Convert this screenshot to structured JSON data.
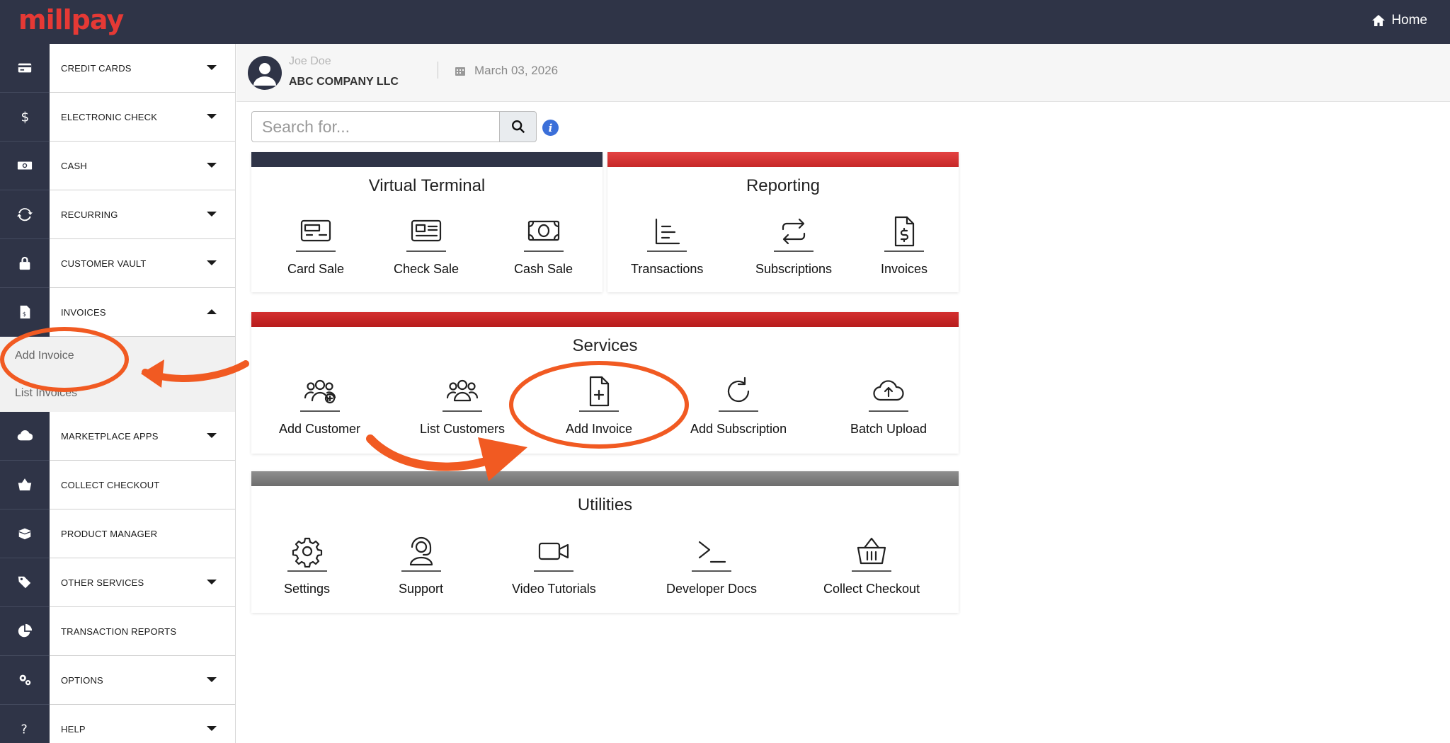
{
  "topbar": {
    "logo": "millpay",
    "home_label": "Home"
  },
  "sidebar": {
    "items": [
      {
        "label": "CREDIT CARDS",
        "icon": "credit-card-icon",
        "caret": "down"
      },
      {
        "label": "ELECTRONIC CHECK",
        "icon": "dollar-icon",
        "caret": "down"
      },
      {
        "label": "CASH",
        "icon": "cash-icon",
        "caret": "down"
      },
      {
        "label": "RECURRING",
        "icon": "refresh-icon",
        "caret": "down"
      },
      {
        "label": "CUSTOMER VAULT",
        "icon": "lock-icon",
        "caret": "down"
      },
      {
        "label": "INVOICES",
        "icon": "invoice-file-icon",
        "caret": "up"
      },
      {
        "label": "MARKETPLACE APPS",
        "icon": "cloud-icon",
        "caret": "down"
      },
      {
        "label": "COLLECT CHECKOUT",
        "icon": "basket-icon",
        "caret": "none"
      },
      {
        "label": "PRODUCT MANAGER",
        "icon": "box-icon",
        "caret": "none"
      },
      {
        "label": "OTHER SERVICES",
        "icon": "tags-icon",
        "caret": "down"
      },
      {
        "label": "TRANSACTION REPORTS",
        "icon": "pie-chart-icon",
        "caret": "none"
      },
      {
        "label": "OPTIONS",
        "icon": "gears-icon",
        "caret": "down"
      },
      {
        "label": "HELP",
        "icon": "question-icon",
        "caret": "down"
      }
    ],
    "invoices_sub": [
      "Add Invoice",
      "List Invoices"
    ]
  },
  "header": {
    "user_name": "Joe Doe",
    "company": "ABC COMPANY LLC",
    "date": "March 03, 2026"
  },
  "search": {
    "placeholder": "Search for..."
  },
  "cards": {
    "virtual_terminal": {
      "title": "Virtual Terminal",
      "tiles": [
        "Card Sale",
        "Check Sale",
        "Cash Sale"
      ]
    },
    "reporting": {
      "title": "Reporting",
      "tiles": [
        "Transactions",
        "Subscriptions",
        "Invoices"
      ]
    },
    "services": {
      "title": "Services",
      "tiles": [
        "Add Customer",
        "List Customers",
        "Add Invoice",
        "Add Subscription",
        "Batch Upload"
      ]
    },
    "utilities": {
      "title": "Utilities",
      "tiles": [
        "Settings",
        "Support",
        "Video Tutorials",
        "Developer Docs",
        "Collect Checkout"
      ]
    }
  },
  "colors": {
    "topbar": "#2f3447",
    "brand": "#e53935",
    "red_bar": "#d32f2f",
    "gray_bar": "#7a7a7a",
    "annotation": "#f15a22"
  }
}
